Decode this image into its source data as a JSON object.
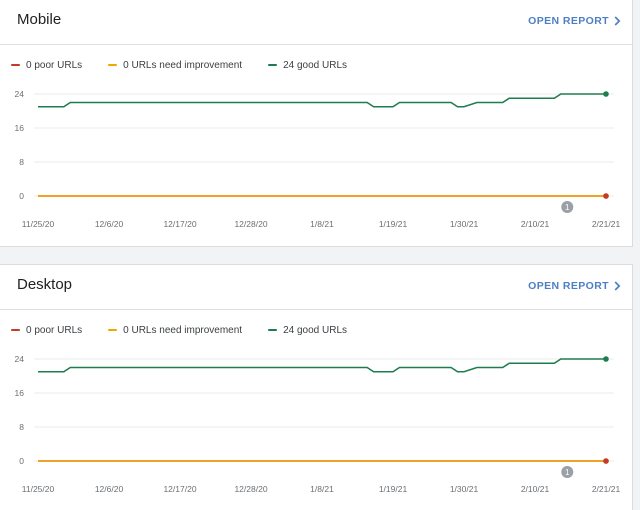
{
  "cards": [
    {
      "title": "Mobile",
      "action_label": "OPEN REPORT",
      "legend": [
        {
          "label": "0 poor URLs",
          "color": "#c5392b"
        },
        {
          "label": "0 URLs need improvement",
          "color": "#f2a600"
        },
        {
          "label": "24 good URLs",
          "color": "#1e7d4f"
        }
      ],
      "chart_data": {
        "type": "line",
        "x": [
          "11/25/20",
          "11/29/20",
          "11/30/20",
          "12/6/20",
          "12/17/20",
          "12/28/20",
          "1/8/21",
          "1/15/21",
          "1/16/21",
          "1/19/21",
          "1/20/21",
          "1/28/21",
          "1/29/21",
          "1/30/21",
          "2/1/21",
          "2/5/21",
          "2/6/21",
          "2/13/21",
          "2/14/21",
          "2/21/21"
        ],
        "series": [
          {
            "name": "24 good URLs",
            "color": "#1e7d4f",
            "values": [
              21,
              21,
              22,
              22,
              22,
              22,
              22,
              22,
              21,
              21,
              22,
              22,
              21,
              21,
              22,
              22,
              23,
              23,
              24,
              24
            ]
          },
          {
            "name": "0 URLs need improvement",
            "color": "#f2a600",
            "values": [
              0,
              0,
              0,
              0,
              0,
              0,
              0,
              0,
              0,
              0,
              0,
              0,
              0,
              0,
              0,
              0,
              0,
              0,
              0,
              0
            ]
          },
          {
            "name": "0 poor URLs",
            "color": "#c5392b",
            "values": [
              0,
              0,
              0,
              0,
              0,
              0,
              0,
              0,
              0,
              0,
              0,
              0,
              0,
              0,
              0,
              0,
              0,
              0,
              0,
              0
            ]
          }
        ],
        "x_ticks": [
          "11/25/20",
          "12/6/20",
          "12/17/20",
          "12/28/20",
          "1/8/21",
          "1/19/21",
          "1/30/21",
          "2/10/21",
          "2/21/21"
        ],
        "y_ticks": [
          0,
          8,
          16,
          24
        ],
        "ylim": [
          0,
          24
        ],
        "annotation": {
          "label": "1",
          "date": "2/15/21"
        },
        "grid": true
      }
    },
    {
      "title": "Desktop",
      "action_label": "OPEN REPORT",
      "legend": [
        {
          "label": "0 poor URLs",
          "color": "#c5392b"
        },
        {
          "label": "0 URLs need improvement",
          "color": "#f2a600"
        },
        {
          "label": "24 good URLs",
          "color": "#1e7d4f"
        }
      ],
      "chart_data": {
        "type": "line",
        "x": [
          "11/25/20",
          "11/29/20",
          "11/30/20",
          "12/6/20",
          "12/17/20",
          "12/28/20",
          "1/8/21",
          "1/15/21",
          "1/16/21",
          "1/19/21",
          "1/20/21",
          "1/28/21",
          "1/29/21",
          "1/30/21",
          "2/1/21",
          "2/5/21",
          "2/6/21",
          "2/13/21",
          "2/14/21",
          "2/21/21"
        ],
        "series": [
          {
            "name": "24 good URLs",
            "color": "#1e7d4f",
            "values": [
              21,
              21,
              22,
              22,
              22,
              22,
              22,
              22,
              21,
              21,
              22,
              22,
              21,
              21,
              22,
              22,
              23,
              23,
              24,
              24
            ]
          },
          {
            "name": "0 URLs need improvement",
            "color": "#f2a600",
            "values": [
              0,
              0,
              0,
              0,
              0,
              0,
              0,
              0,
              0,
              0,
              0,
              0,
              0,
              0,
              0,
              0,
              0,
              0,
              0,
              0
            ]
          },
          {
            "name": "0 poor URLs",
            "color": "#c5392b",
            "values": [
              0,
              0,
              0,
              0,
              0,
              0,
              0,
              0,
              0,
              0,
              0,
              0,
              0,
              0,
              0,
              0,
              0,
              0,
              0,
              0
            ]
          }
        ],
        "x_ticks": [
          "11/25/20",
          "12/6/20",
          "12/17/20",
          "12/28/20",
          "1/8/21",
          "1/19/21",
          "1/30/21",
          "2/10/21",
          "2/21/21"
        ],
        "y_ticks": [
          0,
          8,
          16,
          24
        ],
        "ylim": [
          0,
          24
        ],
        "annotation": {
          "label": "1",
          "date": "2/15/21"
        },
        "grid": true
      }
    }
  ]
}
